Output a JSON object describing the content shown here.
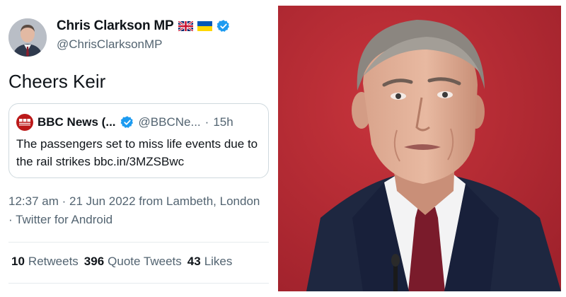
{
  "tweet": {
    "display_name": "Chris Clarkson MP",
    "handle": "@ChrisClarksonMP",
    "text": "Cheers Keir",
    "quote": {
      "name": "BBC News (...",
      "handle": "@BBCNe...",
      "separator": "·",
      "age": "15h",
      "text": "The passengers set to miss life events due to the rail strikes bbc.in/3MZSBwc"
    },
    "timestamp": "12:37 am · 21 Jun 2022 from Lambeth, London · Twitter for Android",
    "stats": [
      {
        "count": "10",
        "label": "Retweets"
      },
      {
        "count": "396",
        "label": "Quote Tweets"
      },
      {
        "count": "43",
        "label": "Likes"
      }
    ]
  },
  "icons": {
    "verified": "verified-badge-icon",
    "uk_flag": "uk-flag-icon",
    "ukraine_flag": "ukraine-flag-icon",
    "bbc_logo": "bbc-news-logo-icon"
  },
  "colors": {
    "verified_blue": "#1d9bf0",
    "secondary_text": "#536471",
    "bbc_red": "#bb1919",
    "photo_background": "#b52a34"
  }
}
